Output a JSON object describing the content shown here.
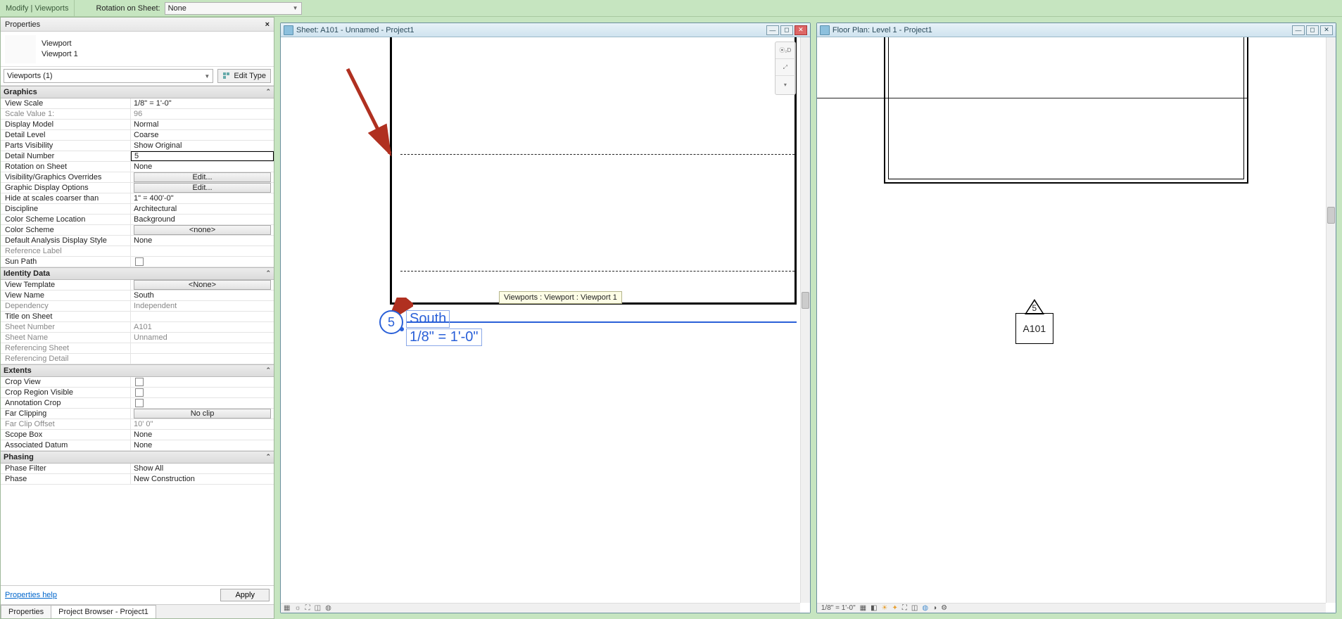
{
  "ribbon": {
    "tab": "Modify | Viewports",
    "rotation_label": "Rotation on Sheet:",
    "rotation_value": "None"
  },
  "properties": {
    "title": "Properties",
    "type_family": "Viewport",
    "type_type": "Viewport 1",
    "instance_filter": "Viewports (1)",
    "edit_type": "Edit Type",
    "groups": {
      "graphics": {
        "label": "Graphics",
        "rows": {
          "view_scale": {
            "l": "View Scale",
            "v": "1/8\" = 1'-0\""
          },
          "scale_value": {
            "l": "Scale Value    1:",
            "v": "96"
          },
          "display_model": {
            "l": "Display Model",
            "v": "Normal"
          },
          "detail_level": {
            "l": "Detail Level",
            "v": "Coarse"
          },
          "parts_vis": {
            "l": "Parts Visibility",
            "v": "Show Original"
          },
          "detail_number": {
            "l": "Detail Number",
            "v": "5"
          },
          "rotation": {
            "l": "Rotation on Sheet",
            "v": "None"
          },
          "vg_overrides": {
            "l": "Visibility/Graphics Overrides",
            "v": "Edit..."
          },
          "gdo": {
            "l": "Graphic Display Options",
            "v": "Edit..."
          },
          "hide_scales": {
            "l": "Hide at scales coarser than",
            "v": "1\" = 400'-0\""
          },
          "discipline": {
            "l": "Discipline",
            "v": "Architectural"
          },
          "cs_loc": {
            "l": "Color Scheme Location",
            "v": "Background"
          },
          "cs": {
            "l": "Color Scheme",
            "v": "<none>"
          },
          "dads": {
            "l": "Default Analysis Display Style",
            "v": "None"
          },
          "ref_label": {
            "l": "Reference Label",
            "v": ""
          },
          "sun_path": {
            "l": "Sun Path",
            "v": ""
          }
        }
      },
      "identity": {
        "label": "Identity Data",
        "rows": {
          "view_template": {
            "l": "View Template",
            "v": "<None>"
          },
          "view_name": {
            "l": "View Name",
            "v": "South"
          },
          "dependency": {
            "l": "Dependency",
            "v": "Independent"
          },
          "title_on_sheet": {
            "l": "Title on Sheet",
            "v": ""
          },
          "sheet_number": {
            "l": "Sheet Number",
            "v": "A101"
          },
          "sheet_name": {
            "l": "Sheet Name",
            "v": "Unnamed"
          },
          "ref_sheet": {
            "l": "Referencing Sheet",
            "v": ""
          },
          "ref_detail": {
            "l": "Referencing Detail",
            "v": ""
          }
        }
      },
      "extents": {
        "label": "Extents",
        "rows": {
          "crop_view": {
            "l": "Crop View",
            "v": ""
          },
          "crop_region": {
            "l": "Crop Region Visible",
            "v": ""
          },
          "anno_crop": {
            "l": "Annotation Crop",
            "v": ""
          },
          "far_clip": {
            "l": "Far Clipping",
            "v": "No clip"
          },
          "far_clip_off": {
            "l": "Far Clip Offset",
            "v": "10'  0\""
          },
          "scope_box": {
            "l": "Scope Box",
            "v": "None"
          },
          "assoc_datum": {
            "l": "Associated Datum",
            "v": "None"
          }
        }
      },
      "phasing": {
        "label": "Phasing",
        "rows": {
          "phase_filter": {
            "l": "Phase Filter",
            "v": "Show All"
          },
          "phase": {
            "l": "Phase",
            "v": "New Construction"
          }
        }
      }
    },
    "help_link": "Properties help",
    "apply": "Apply"
  },
  "tabs": {
    "properties": "Properties",
    "browser": "Project Browser - Project1"
  },
  "left_view": {
    "title": "Sheet: A101 - Unnamed - Project1",
    "tooltip": "Viewports : Viewport : Viewport 1",
    "detail_num": "5",
    "view_name": "South",
    "view_scale": "1/8\" = 1'-0\""
  },
  "right_view": {
    "title": "Floor Plan: Level 1 - Project1",
    "marker_num": "5",
    "marker_sheet": "A101",
    "status_scale": "1/8\" = 1'-0\""
  }
}
